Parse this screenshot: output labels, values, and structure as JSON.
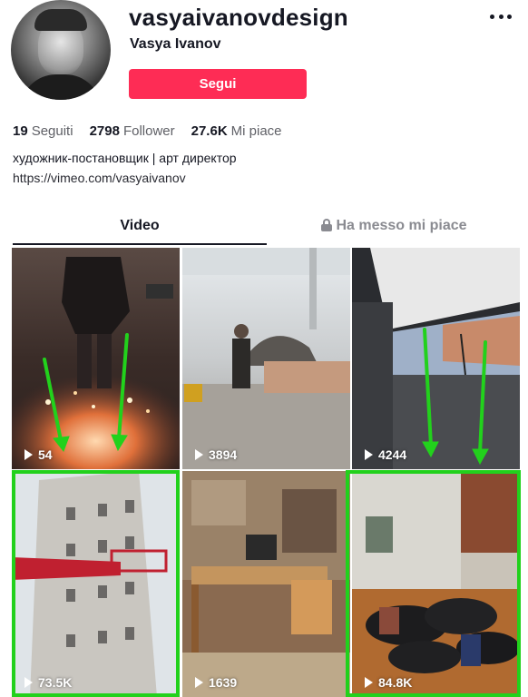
{
  "profile": {
    "username": "vasyaivanovdesign",
    "nickname": "Vasya Ivanov",
    "follow_label": "Segui",
    "more_icon": "more-horizontal-icon"
  },
  "stats": [
    {
      "value": "19",
      "label": "Seguiti"
    },
    {
      "value": "2798",
      "label": "Follower"
    },
    {
      "value": "27.6K",
      "label": "Mi piace"
    }
  ],
  "bio": {
    "text": "художник-постановщик | арт директор",
    "link": "https://vimeo.com/vasyaivanov"
  },
  "tabs": {
    "video": "Video",
    "liked": "Ha messo mi piace"
  },
  "videos": [
    {
      "views": "54"
    },
    {
      "views": "3894"
    },
    {
      "views": "4244"
    },
    {
      "views": "73.5K"
    },
    {
      "views": "1639"
    },
    {
      "views": "84.8K"
    }
  ],
  "colors": {
    "accent": "#fe2c55",
    "highlight": "#22d11c"
  }
}
